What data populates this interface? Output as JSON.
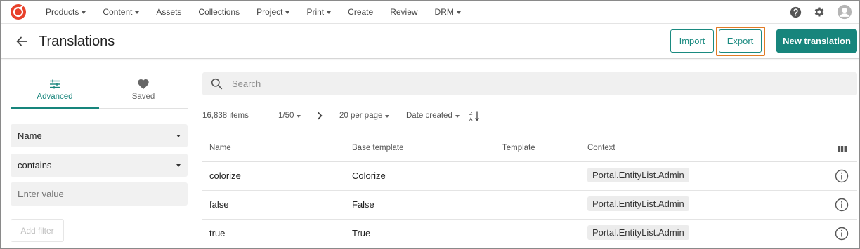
{
  "nav": {
    "items": [
      {
        "label": "Products",
        "dropdown": true
      },
      {
        "label": "Content",
        "dropdown": true
      },
      {
        "label": "Assets",
        "dropdown": false
      },
      {
        "label": "Collections",
        "dropdown": false
      },
      {
        "label": "Project",
        "dropdown": true
      },
      {
        "label": "Print",
        "dropdown": true
      },
      {
        "label": "Create",
        "dropdown": false
      },
      {
        "label": "Review",
        "dropdown": false
      },
      {
        "label": "DRM",
        "dropdown": true
      }
    ],
    "icons": [
      "help-icon",
      "gear-icon",
      "user-avatar-icon"
    ]
  },
  "header": {
    "title": "Translations",
    "import_label": "Import",
    "export_label": "Export",
    "new_label": "New translation"
  },
  "filters": {
    "tabs": [
      {
        "label": "Advanced",
        "icon": "sliders-icon",
        "active": true
      },
      {
        "label": "Saved",
        "icon": "heart-icon",
        "active": false
      }
    ],
    "field_value": "Name",
    "operator_value": "contains",
    "value_placeholder": "Enter value",
    "add_filter_label": "Add filter"
  },
  "search": {
    "placeholder": "Search"
  },
  "toolbar": {
    "items_count": "16,838 items",
    "page": "1/50",
    "per_page": "20 per page",
    "sort_by": "Date created"
  },
  "table": {
    "columns": [
      "Name",
      "Base template",
      "Template",
      "Context"
    ],
    "rows": [
      {
        "name": "colorize",
        "base": "Colorize",
        "template": "",
        "context": "Portal.EntityList.Admin"
      },
      {
        "name": "false",
        "base": "False",
        "template": "",
        "context": "Portal.EntityList.Admin"
      },
      {
        "name": "true",
        "base": "True",
        "template": "",
        "context": "Portal.EntityList.Admin"
      }
    ]
  },
  "colors": {
    "accent": "#17857c",
    "highlight": "#e07b25",
    "logo": "#e8412b"
  }
}
